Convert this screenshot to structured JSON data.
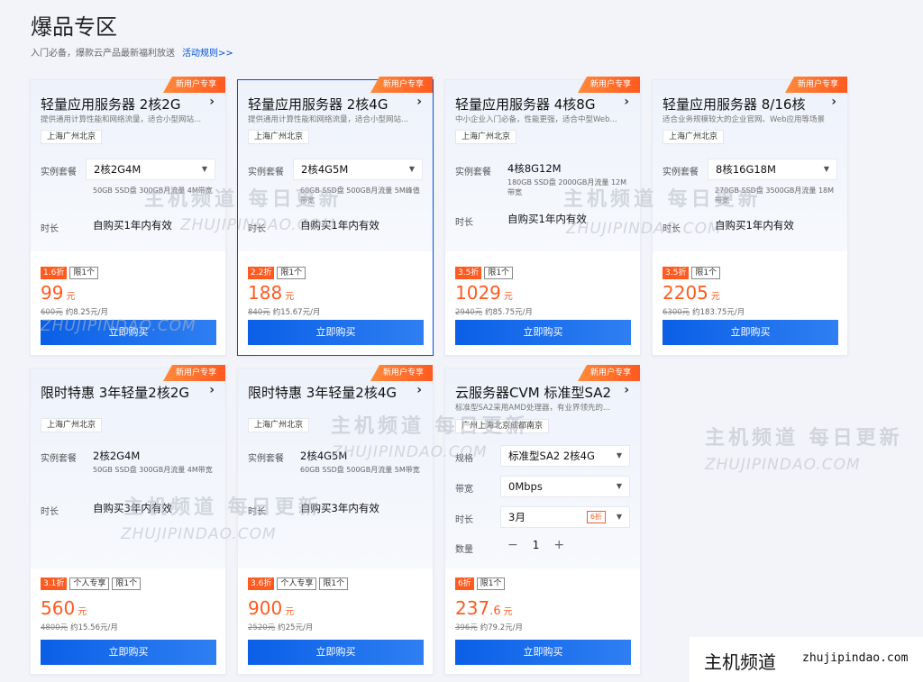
{
  "page": {
    "title": "爆品专区",
    "subtitle": "入门必备，爆款云产品最新福利放送",
    "rules_link": "活动规则>>"
  },
  "labels": {
    "instance": "实例套餐",
    "duration": "时长",
    "spec": "规格",
    "bandwidth": "带宽",
    "quantity": "数量",
    "buy": "立即购买",
    "arrow": "›",
    "minus": "−",
    "plus": "+"
  },
  "cards": [
    {
      "ribbon": "新用户专享",
      "title": "轻量应用服务器 2核2G",
      "desc": "提供通用计算性能和网络流量，适合小型网站...",
      "region": "上海广州北京",
      "instance": "2核2G4M",
      "spec_note": "50GB SSD盘 300GB月流量 4M带宽",
      "duration": "自购买1年内有效",
      "badges": [
        "1.6折",
        "限1个"
      ],
      "price": "99",
      "unit": "元",
      "old_price": "600元",
      "monthly": "约8.25元/月"
    },
    {
      "ribbon": "新用户专享",
      "title": "轻量应用服务器 2核4G",
      "desc": "提供通用计算性能和网络流量，适合小型网站...",
      "region": "上海广州北京",
      "instance": "2核4G5M",
      "spec_note": "60GB SSD盘 500GB月流量 5M峰值带宽",
      "duration": "自购买1年内有效",
      "badges": [
        "2.2折",
        "限1个"
      ],
      "price": "188",
      "unit": "元",
      "old_price": "840元",
      "monthly": "约15.67元/月"
    },
    {
      "ribbon": "新用户专享",
      "title": "轻量应用服务器 4核8G",
      "desc": "中小企业入门必备，性能更强，适合中型Web...",
      "region": "上海广州北京",
      "instance": "4核8G12M",
      "spec_note": "180GB SSD盘 2000GB月流量 12M带宽",
      "duration": "自购买1年内有效",
      "badges": [
        "3.5折",
        "限1个"
      ],
      "price": "1029",
      "unit": "元",
      "old_price": "2940元",
      "monthly": "约85.75元/月"
    },
    {
      "ribbon": "新用户专享",
      "title": "轻量应用服务器 8/16核",
      "desc": "适合业务规模较大的企业官网、Web应用等场景",
      "region": "上海广州北京",
      "instance": "8核16G18M",
      "spec_note": "270GB SSD盘 3500GB月流量 18M带宽",
      "duration": "自购买1年内有效",
      "badges": [
        "3.5折",
        "限1个"
      ],
      "price": "2205",
      "unit": "元",
      "old_price": "6300元",
      "monthly": "约183.75元/月"
    },
    {
      "ribbon": "新用户专享",
      "title": "限时特惠 3年轻量2核2G",
      "region": "上海广州北京",
      "instance": "2核2G4M",
      "spec_note": "50GB SSD盘 300GB月流量 4M带宽",
      "duration": "自购买3年内有效",
      "badges": [
        "3.1折",
        "个人专享",
        "限1个"
      ],
      "price": "560",
      "unit": "元",
      "old_price": "4800元",
      "monthly": "约15.56元/月"
    },
    {
      "ribbon": "新用户专享",
      "title": "限时特惠 3年轻量2核4G",
      "region": "上海广州北京",
      "instance": "2核4G5M",
      "spec_note": "60GB SSD盘 500GB月流量 5M带宽",
      "duration": "自购买3年内有效",
      "badges": [
        "3.6折",
        "个人专享",
        "限1个"
      ],
      "price": "900",
      "unit": "元",
      "old_price": "2520元",
      "monthly": "约25元/月"
    },
    {
      "ribbon": "新用户专享",
      "title": "云服务器CVM 标准型SA2",
      "desc": "标准型SA2采用AMD处理器，有业界领先的...",
      "region": "广州上海北京成都南京",
      "spec_select": "标准型SA2 2核4G",
      "bandwidth_select": "0Mbps",
      "duration_select": "3月",
      "duration_disc": "6折",
      "quantity": "1",
      "badges": [
        "6折",
        "限1个"
      ],
      "price": "237",
      "price_dec": ".6",
      "unit": "元",
      "old_price": "396元",
      "monthly": "约79.2元/月"
    }
  ],
  "watermark": {
    "cn": "主机频道 每日更新",
    "en": "ZHUJIPINDAO.COM"
  },
  "footer": {
    "cn": "主机频道",
    "url": "zhujipindao.com"
  },
  "colors": {
    "accent": "#0052d9",
    "discount": "#ff5a1f"
  }
}
